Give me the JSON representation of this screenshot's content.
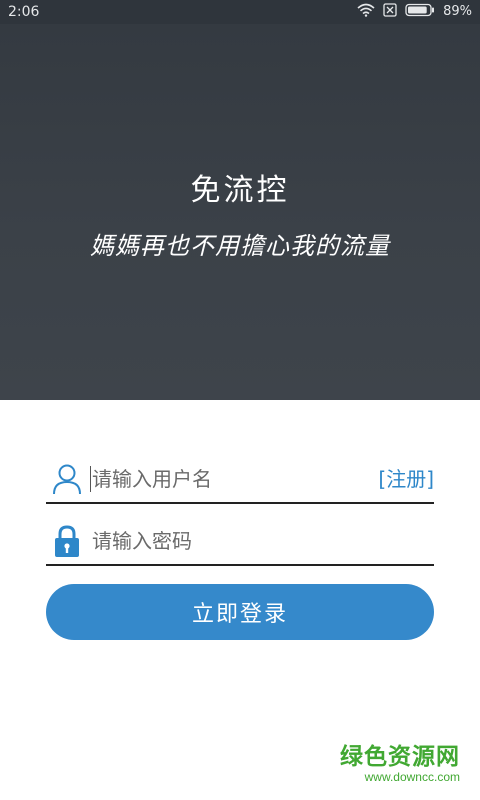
{
  "status_bar": {
    "time": "2:06",
    "battery_percent": "89%",
    "battery_level": 0.89
  },
  "hero": {
    "title": "免流控",
    "subtitle": "媽媽再也不用擔心我的流量"
  },
  "login_form": {
    "username_placeholder": "请输入用户名",
    "register_label": "[注册]",
    "password_placeholder": "请输入密码",
    "login_button_label": "立即登录"
  },
  "watermark": {
    "title": "绿色资源网",
    "url": "www.downcc.com"
  },
  "colors": {
    "hero_background": "#3b4148",
    "accent_blue": "#3589cb",
    "link_blue": "#2e87c9",
    "watermark_green": "#41a832"
  },
  "icons": {
    "wifi": "wifi-icon",
    "no_sim": "no-sim-icon",
    "battery": "battery-icon",
    "user": "user-icon",
    "lock": "lock-icon"
  }
}
